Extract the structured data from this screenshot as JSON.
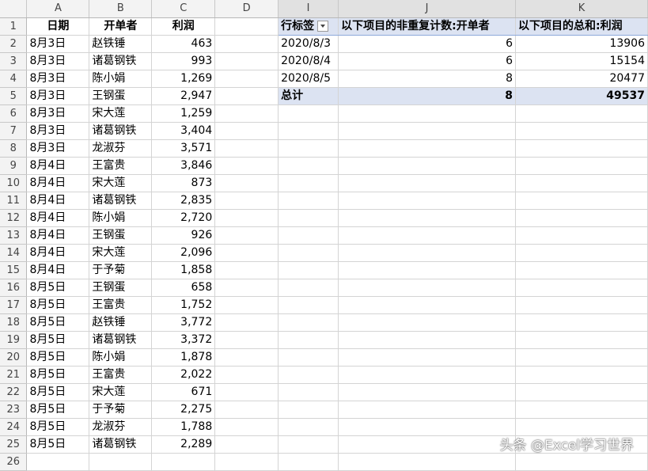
{
  "columns": [
    "A",
    "B",
    "C",
    "D",
    "I",
    "J",
    "K"
  ],
  "rows": [
    {
      "n": "1",
      "a": "日期",
      "b": "开单者",
      "c": "利润"
    },
    {
      "n": "2",
      "a": "8月3日",
      "b": "赵铁锤",
      "c": "463"
    },
    {
      "n": "3",
      "a": "8月3日",
      "b": "诸葛钢铁",
      "c": "993"
    },
    {
      "n": "4",
      "a": "8月3日",
      "b": "陈小娟",
      "c": "1,269"
    },
    {
      "n": "5",
      "a": "8月3日",
      "b": "王钢蛋",
      "c": "2,947"
    },
    {
      "n": "6",
      "a": "8月3日",
      "b": "宋大莲",
      "c": "1,259"
    },
    {
      "n": "7",
      "a": "8月3日",
      "b": "诸葛钢铁",
      "c": "3,404"
    },
    {
      "n": "8",
      "a": "8月3日",
      "b": "龙淑芬",
      "c": "3,571"
    },
    {
      "n": "9",
      "a": "8月4日",
      "b": "王富贵",
      "c": "3,846"
    },
    {
      "n": "10",
      "a": "8月4日",
      "b": "宋大莲",
      "c": "873"
    },
    {
      "n": "11",
      "a": "8月4日",
      "b": "诸葛钢铁",
      "c": "2,835"
    },
    {
      "n": "12",
      "a": "8月4日",
      "b": "陈小娟",
      "c": "2,720"
    },
    {
      "n": "13",
      "a": "8月4日",
      "b": "王钢蛋",
      "c": "926"
    },
    {
      "n": "14",
      "a": "8月4日",
      "b": "宋大莲",
      "c": "2,096"
    },
    {
      "n": "15",
      "a": "8月4日",
      "b": "于予菊",
      "c": "1,858"
    },
    {
      "n": "16",
      "a": "8月5日",
      "b": "王钢蛋",
      "c": "658"
    },
    {
      "n": "17",
      "a": "8月5日",
      "b": "王富贵",
      "c": "1,752"
    },
    {
      "n": "18",
      "a": "8月5日",
      "b": "赵铁锤",
      "c": "3,772"
    },
    {
      "n": "19",
      "a": "8月5日",
      "b": "诸葛钢铁",
      "c": "3,372"
    },
    {
      "n": "20",
      "a": "8月5日",
      "b": "陈小娟",
      "c": "1,878"
    },
    {
      "n": "21",
      "a": "8月5日",
      "b": "王富贵",
      "c": "2,022"
    },
    {
      "n": "22",
      "a": "8月5日",
      "b": "宋大莲",
      "c": "671"
    },
    {
      "n": "23",
      "a": "8月5日",
      "b": "于予菊",
      "c": "2,275"
    },
    {
      "n": "24",
      "a": "8月5日",
      "b": "龙淑芬",
      "c": "1,788"
    },
    {
      "n": "25",
      "a": "8月5日",
      "b": "诸葛钢铁",
      "c": "2,289"
    }
  ],
  "pivot": {
    "header": {
      "i": "行标签",
      "j": "以下项目的非重复计数:开单者",
      "k": "以下项目的总和:利润"
    },
    "rows": [
      {
        "i": "2020/8/3",
        "j": "6",
        "k": "13906"
      },
      {
        "i": "2020/8/4",
        "j": "6",
        "k": "15154"
      },
      {
        "i": "2020/8/5",
        "j": "8",
        "k": "20477"
      }
    ],
    "total": {
      "i": "总计",
      "j": "8",
      "k": "49537"
    }
  },
  "next_row_label": "26",
  "watermark": "头条 @Excel学习世界"
}
